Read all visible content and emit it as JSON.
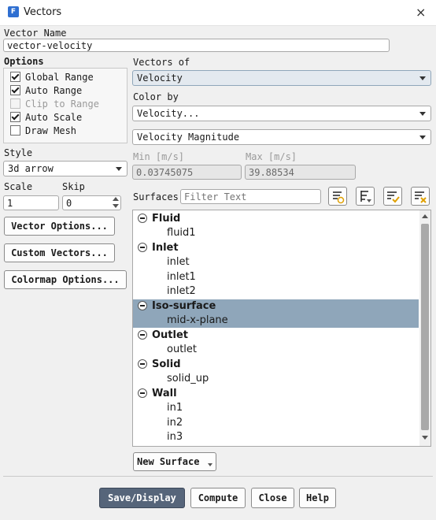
{
  "window": {
    "title": "Vectors",
    "app_icon": "fluent-app-icon",
    "close_icon": "×"
  },
  "vector_name": {
    "label": "Vector Name",
    "value": "vector-velocity"
  },
  "options": {
    "label": "Options",
    "items": [
      {
        "label": "Global Range",
        "checked": true,
        "enabled": true
      },
      {
        "label": "Auto Range",
        "checked": true,
        "enabled": true
      },
      {
        "label": "Clip to Range",
        "checked": false,
        "enabled": false
      },
      {
        "label": "Auto Scale",
        "checked": true,
        "enabled": true
      },
      {
        "label": "Draw Mesh",
        "checked": false,
        "enabled": true
      }
    ]
  },
  "style": {
    "label": "Style",
    "value": "3d arrow"
  },
  "scale": {
    "label": "Scale",
    "value": "1"
  },
  "skip": {
    "label": "Skip",
    "value": "0"
  },
  "left_buttons": {
    "vector_options": "Vector Options...",
    "custom_vectors": "Custom Vectors...",
    "colormap_options": "Colormap Options..."
  },
  "vectors_of": {
    "label": "Vectors of",
    "value": "Velocity"
  },
  "color_by": {
    "label": "Color by",
    "value": "Velocity...",
    "sub_value": "Velocity Magnitude"
  },
  "range": {
    "min_label": "Min [m/s]",
    "min_value": "0.03745075",
    "max_label": "Max [m/s]",
    "max_value": "39.88534"
  },
  "surfaces": {
    "label": "Surfaces",
    "filter_placeholder": "Filter Text",
    "groups": [
      {
        "name": "Fluid",
        "children": [
          "fluid1"
        ]
      },
      {
        "name": "Inlet",
        "children": [
          "inlet",
          "inlet1",
          "inlet2"
        ]
      },
      {
        "name": "Iso-surface",
        "children": [
          "mid-x-plane"
        ],
        "selected": true
      },
      {
        "name": "Outlet",
        "children": [
          "outlet"
        ]
      },
      {
        "name": "Solid",
        "children": [
          "solid_up"
        ]
      },
      {
        "name": "Wall",
        "children": [
          "in1",
          "in2",
          "in3"
        ]
      }
    ],
    "new_surface": "New Surface"
  },
  "bottom_buttons": {
    "save_display": "Save/Display",
    "compute": "Compute",
    "close": "Close",
    "help": "Help"
  },
  "colors": {
    "accent": "#56657a",
    "selection": "#8fa6ba",
    "selected_dropdown": "#e3e9ef",
    "background": "#f0f0f0"
  }
}
